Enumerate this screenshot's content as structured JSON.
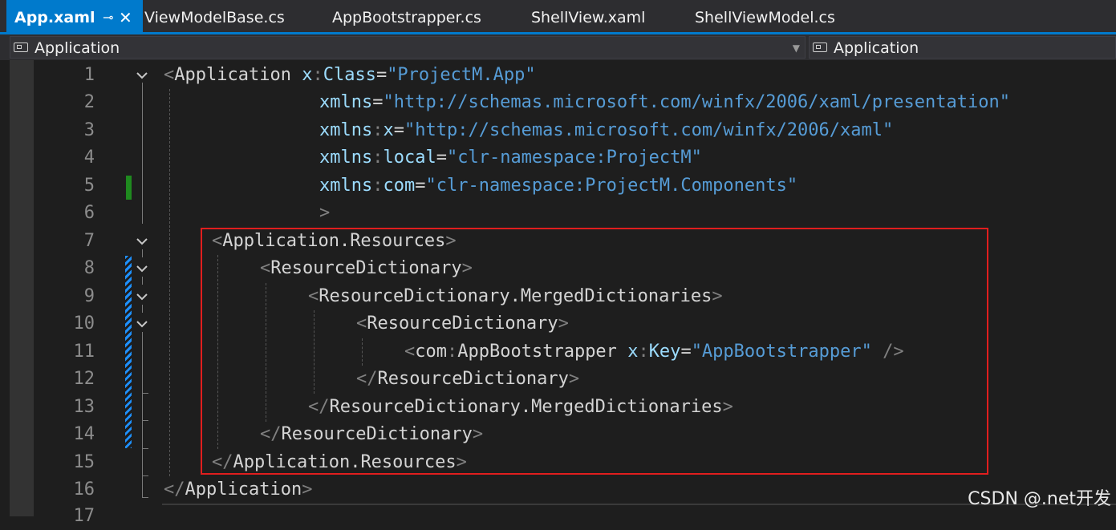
{
  "tabs": [
    {
      "label": "App.xaml",
      "active": true,
      "pin": "⊸",
      "close": "✕"
    },
    {
      "label": "ViewModelBase.cs",
      "active": false
    },
    {
      "label": "AppBootstrapper.cs",
      "active": false
    },
    {
      "label": "ShellView.xaml",
      "active": false
    },
    {
      "label": "ShellViewModel.cs",
      "active": false
    }
  ],
  "navbar": {
    "left_combo": "Application",
    "right_combo": "Application"
  },
  "line_numbers": [
    "1",
    "2",
    "3",
    "4",
    "5",
    "6",
    "7",
    "8",
    "9",
    "10",
    "11",
    "12",
    "13",
    "14",
    "15",
    "16",
    "17"
  ],
  "code": {
    "l1": {
      "open": "<",
      "tag": "Application",
      "attr_pre": "x",
      "colon": ":",
      "attr": "Class",
      "eq": "=",
      "value": "\"ProjectM.App\""
    },
    "l2": {
      "attr": "xmlns",
      "eq": "=",
      "value": "\"http://schemas.microsoft.com/winfx/2006/xaml/presentation\""
    },
    "l3": {
      "attr": "xmlns",
      "colon": ":",
      "attr2": "x",
      "eq": "=",
      "value": "\"http://schemas.microsoft.com/winfx/2006/xaml\""
    },
    "l4": {
      "attr": "xmlns",
      "colon": ":",
      "attr2": "local",
      "eq": "=",
      "value": "\"clr-namespace:ProjectM\""
    },
    "l5": {
      "attr": "xmlns",
      "colon": ":",
      "attr2": "com",
      "eq": "=",
      "value": "\"clr-namespace:ProjectM.Components\""
    },
    "l6": {
      "close": ">"
    },
    "l7": {
      "open": "<",
      "tag": "Application.Resources",
      "close": ">"
    },
    "l8": {
      "open": "<",
      "tag": "ResourceDictionary",
      "close": ">"
    },
    "l9": {
      "open": "<",
      "tag": "ResourceDictionary.MergedDictionaries",
      "close": ">"
    },
    "l10": {
      "open": "<",
      "tag": "ResourceDictionary",
      "close": ">"
    },
    "l11": {
      "open": "<",
      "ns": "com",
      "colon": ":",
      "tag": "AppBootstrapper",
      "attr_pre": "x",
      "attr": "Key",
      "eq": "=",
      "value": "\"AppBootstrapper\"",
      "close": " />"
    },
    "l12": {
      "open": "</",
      "tag": "ResourceDictionary",
      "close": ">"
    },
    "l13": {
      "open": "</",
      "tag": "ResourceDictionary.MergedDictionaries",
      "close": ">"
    },
    "l14": {
      "open": "</",
      "tag": "ResourceDictionary",
      "close": ">"
    },
    "l15": {
      "open": "</",
      "tag": "Application.Resources",
      "close": ">"
    },
    "l16": {
      "open": "</",
      "tag": "Application",
      "close": ">"
    }
  },
  "watermark": "CSDN @.net开发"
}
